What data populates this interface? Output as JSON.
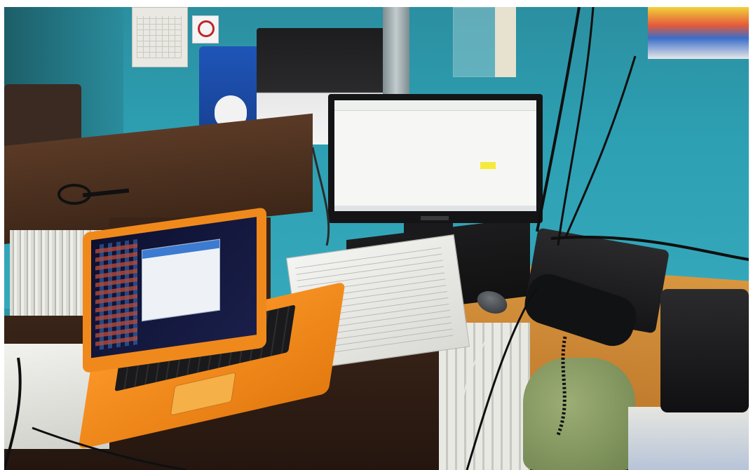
{
  "image": {
    "width": 1074,
    "height": 670,
    "colors": {
      "wall": "#2da0b3",
      "desk_wood": "#d8963f",
      "laptop_orange": "#f0891c",
      "monitor_black": "#141416",
      "screen_white": "#f6f7f4",
      "highlight_yellow": "#f5ea3b",
      "mailbox_blue": "#1f55b8"
    }
  },
  "objects": [
    {
      "name": "wall-calendar",
      "icon": "calendar-icon"
    },
    {
      "name": "no-entry-sign",
      "icon": "prohibition-sign-icon"
    },
    {
      "name": "blue-mailbox",
      "icon": "mailbox-icon"
    },
    {
      "name": "office-printer",
      "icon": "printer-icon"
    },
    {
      "name": "desktop-monitor",
      "icon": "monitor-icon"
    },
    {
      "name": "desktop-pc-case",
      "icon": "computer-case-icon"
    },
    {
      "name": "orange-laptop",
      "icon": "laptop-icon"
    },
    {
      "name": "black-mouse",
      "icon": "mouse-icon"
    },
    {
      "name": "gray-mouse",
      "icon": "mouse-icon"
    },
    {
      "name": "desk-telephone",
      "icon": "telephone-icon"
    },
    {
      "name": "receipt-printer",
      "icon": "receipt-printer-icon"
    },
    {
      "name": "magnifying-glass",
      "icon": "magnifier-icon"
    },
    {
      "name": "paper-pile",
      "icon": "documents-icon"
    },
    {
      "name": "radiator",
      "icon": "radiator-icon"
    },
    {
      "name": "storage-sack",
      "icon": "sack-icon"
    },
    {
      "name": "cable-bundle",
      "icon": "cable-icon"
    }
  ]
}
